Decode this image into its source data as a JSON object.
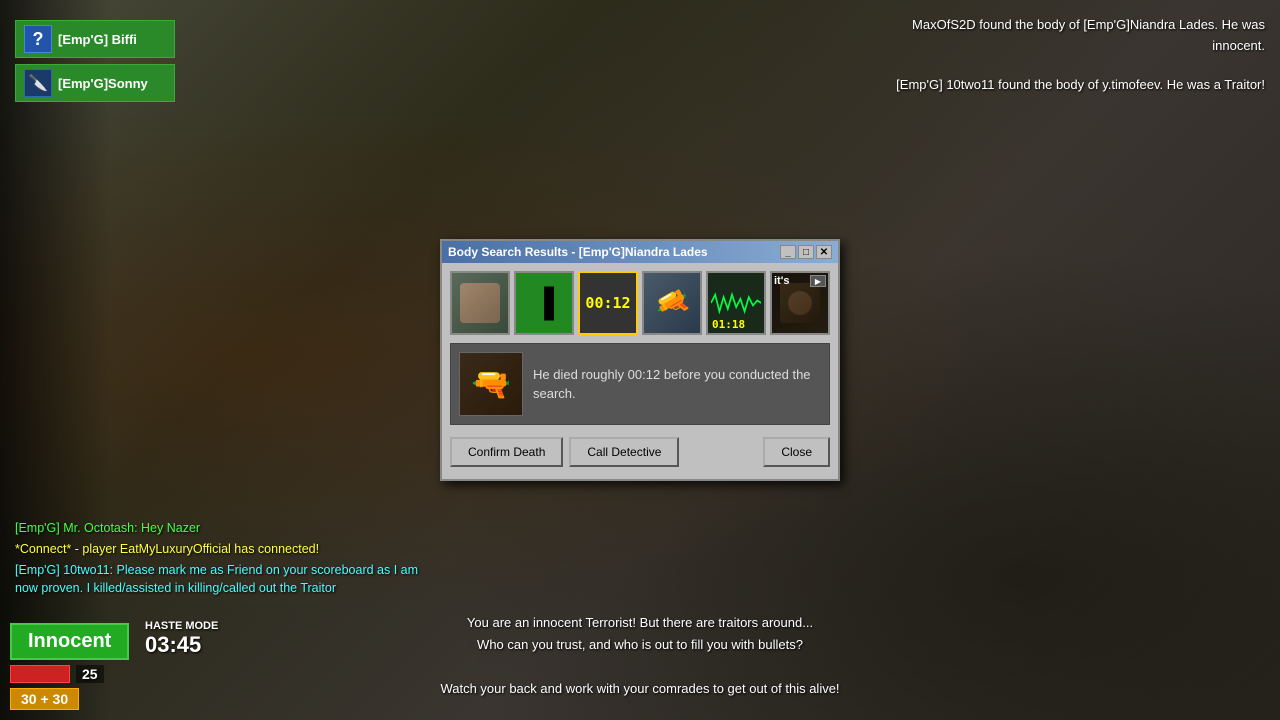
{
  "background": {
    "color": "#3a3a2a"
  },
  "players": [
    {
      "name": "[Emp'G] Biffi",
      "icon_type": "unknown",
      "icon_symbol": "?"
    },
    {
      "name": "[Emp'G]Sonny",
      "icon_type": "knife",
      "icon_symbol": "🔪"
    }
  ],
  "notifications": [
    "MaxOfS2D found the body of [Emp'G]Niandra Lades. He was innocent.",
    "[Emp'G] 10two11 found the body of y.timofeev. He was a Traitor!"
  ],
  "chat": [
    {
      "text": "[Emp'G] Mr. Octotash: Hey Nazer",
      "style": "green"
    },
    {
      "text": "*Connect* - player EatMyLuxuryOfficial has connected!",
      "style": "yellow"
    },
    {
      "text": "[Emp'G] 10two11: Please mark me as Friend on your scoreboard as I am now proven. I killed/assisted in killing/called out the Traitor",
      "style": "cyan"
    }
  ],
  "status": {
    "role": "Innocent",
    "haste_label": "HASTE MODE",
    "timer": "03:45",
    "health": 25,
    "ammo": "30 + 30"
  },
  "bottom_message": [
    "You are an innocent Terrorist! But there are traitors around...",
    "Who can you trust, and who is out to fill you with bullets?",
    "",
    "Watch your back and work with your comrades to get out of this alive!"
  ],
  "modal": {
    "title": "Body Search Results - [Emp'G]Niandra Lades",
    "evidence_items": [
      {
        "type": "avatar",
        "label": "avatar"
      },
      {
        "type": "role",
        "label": "innocent"
      },
      {
        "type": "time",
        "value": "00:12",
        "selected": true
      },
      {
        "type": "weapon",
        "label": "rifle"
      },
      {
        "type": "wavy",
        "value": "01:18"
      },
      {
        "type": "suspect",
        "label": "suspect"
      }
    ],
    "info_text": "He died roughly 00:12 before you conducted the search.",
    "buttons": {
      "confirm": "Confirm Death",
      "detective": "Call Detective",
      "close": "Close"
    }
  }
}
